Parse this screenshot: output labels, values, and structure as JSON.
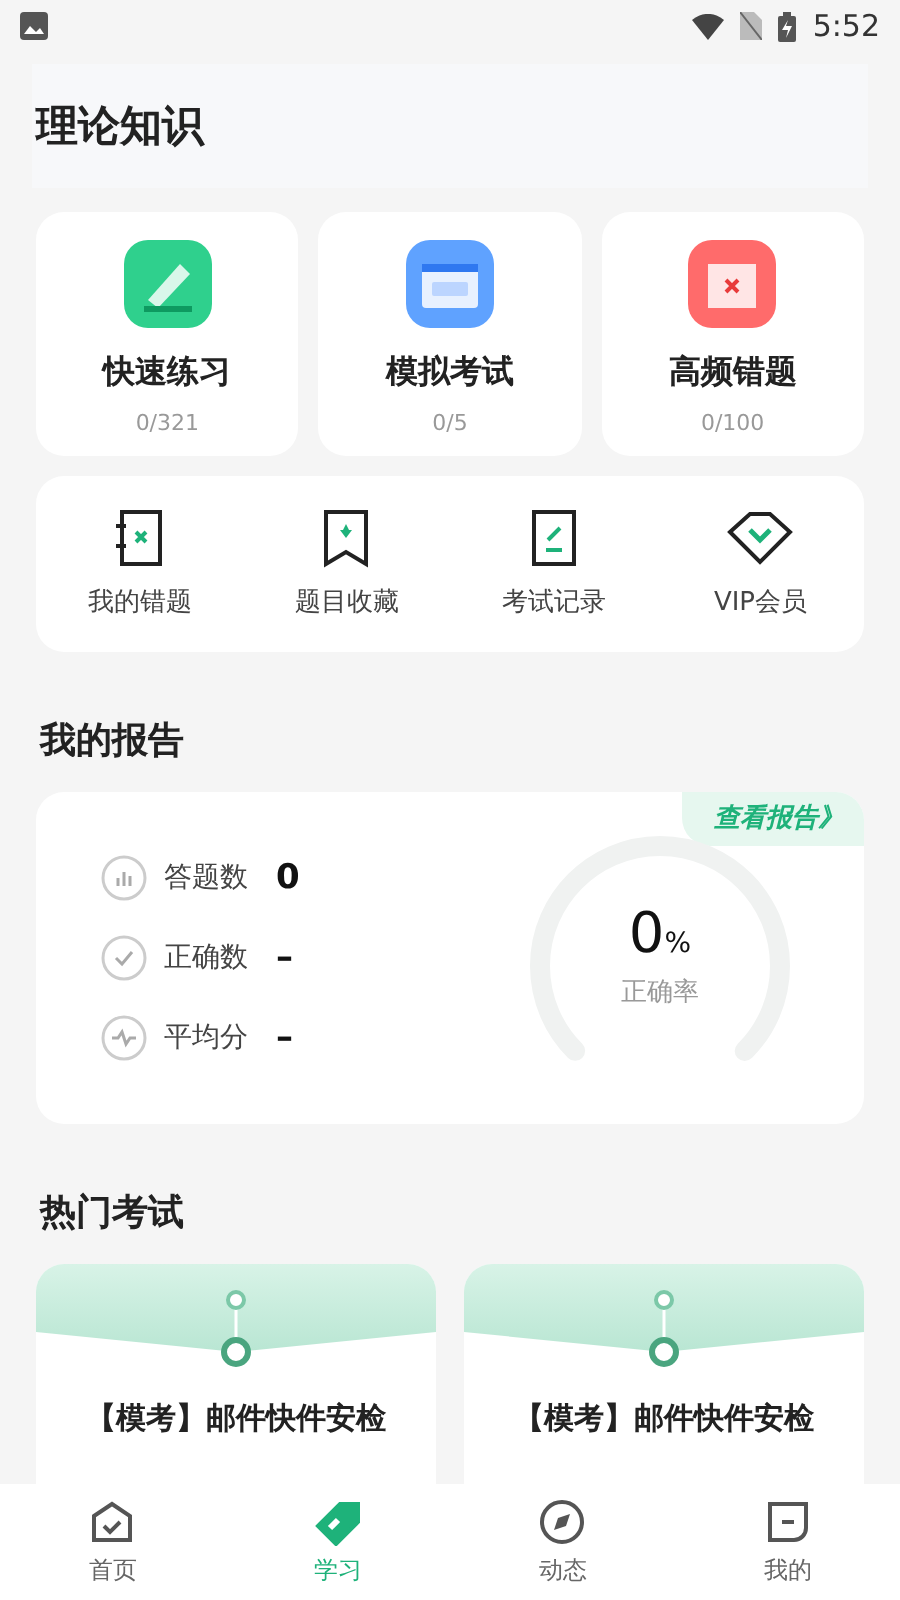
{
  "status_bar": {
    "time": "5:52"
  },
  "section_title": "理论知识",
  "practice_cards": [
    {
      "kind": "practice",
      "label": "快速练习",
      "progress": "0/321"
    },
    {
      "kind": "exam",
      "label": "模拟考试",
      "progress": "0/5"
    },
    {
      "kind": "mistakes",
      "label": "高频错题",
      "progress": "0/100"
    }
  ],
  "shortcuts": [
    {
      "kind": "mistakes",
      "label": "我的错题"
    },
    {
      "kind": "favorites",
      "label": "题目收藏"
    },
    {
      "kind": "records",
      "label": "考试记录"
    },
    {
      "kind": "vip",
      "label": "VIP会员"
    }
  ],
  "report": {
    "title": "我的报告",
    "link": "查看报告》",
    "stats": [
      {
        "kind": "answered",
        "label": "答题数",
        "value": "0"
      },
      {
        "kind": "correct",
        "label": "正确数",
        "value": "–"
      },
      {
        "kind": "average",
        "label": "平均分",
        "value": "–"
      }
    ],
    "gauge": {
      "value": "0",
      "unit": "%",
      "label": "正确率"
    }
  },
  "hot_exams": {
    "title": "热门考试",
    "cards": [
      {
        "title": "【模考】邮件快件安检"
      },
      {
        "title": "【模考】邮件快件安检"
      }
    ]
  },
  "tabs": [
    {
      "kind": "home",
      "label": "首页",
      "selected": false
    },
    {
      "kind": "study",
      "label": "学习",
      "selected": true
    },
    {
      "kind": "feed",
      "label": "动态",
      "selected": false
    },
    {
      "kind": "me",
      "label": "我的",
      "selected": false
    }
  ]
}
